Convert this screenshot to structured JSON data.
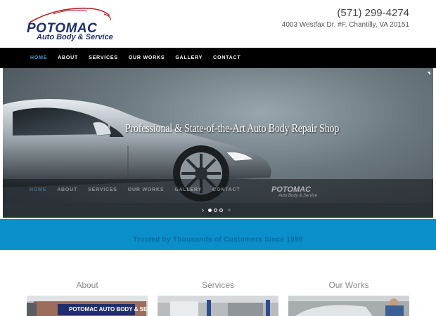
{
  "header": {
    "logo_main": "POTOMAC",
    "logo_sub": "Auto Body & Service",
    "phone": "(571) 299-4274",
    "address": "4003 Westfax Dr. #F, Chantilly, VA 20151"
  },
  "nav": {
    "items": [
      {
        "label": "HOME",
        "active": true
      },
      {
        "label": "ABOUT",
        "active": false
      },
      {
        "label": "SERVICES",
        "active": false
      },
      {
        "label": "OUR WORKS",
        "active": false
      },
      {
        "label": "GALLERY",
        "active": false
      },
      {
        "label": "CONTACT",
        "active": false
      }
    ]
  },
  "hero": {
    "caption": "Professional & State-of-the-Art Auto Body Repair Shop",
    "overlay_logo_main": "POTOMAC",
    "overlay_logo_sub": "Auto Body & Service",
    "next_arrow": "›",
    "pause": "ıı",
    "slide_count": 3,
    "active_slide": 0
  },
  "band": {
    "text": "Trusted by Thousands of Customers Since 1998"
  },
  "columns": [
    {
      "title": "About",
      "thumb_text": "POTOMAC AUTO BODY & SERVICE"
    },
    {
      "title": "Services"
    },
    {
      "title": "Our Works"
    }
  ],
  "colors": {
    "nav_bg": "#000000",
    "nav_active": "#3aa0d8",
    "band_bg": "#0a8fcb",
    "band_text": "#0e6a98",
    "logo": "#1d2f6b",
    "logo_swoosh": "#b32025"
  }
}
